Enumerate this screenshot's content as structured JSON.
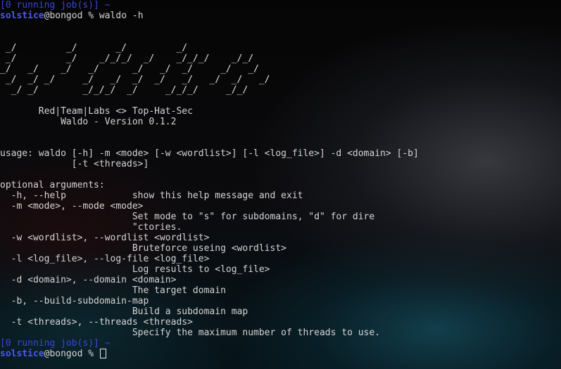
{
  "terminal": {
    "colors": {
      "prompt_user": "#4a58f0",
      "jobs_text": "#3a46d8",
      "text": "#d4d4d4"
    },
    "top_jobs": "[0 running job(s)] ~",
    "prompt1": {
      "user": "solstice",
      "host": "@bongod",
      "rest": " % waldo -h"
    },
    "banner": [
      " _/         _/       _/         _/",
      " _/         _/    _/_/_/  _/    _/_/_/    _/_/",
      "_/   _/    _/   _/      _/   _/  _/     _/   _/",
      " _/  _/ _/     _/   _/  _/  _/   _/   _/  _/   _/",
      "  _/ _/        _/_/_/  _/     _/_/_/     _/_/"
    ],
    "credits": [
      "       Red|Team|Labs <> Top-Hat-Sec",
      "           Waldo - Version 0.1.2"
    ],
    "usage": [
      "usage: waldo [-h] -m <mode> [-w <wordlist>] [-l <log_file>] -d <domain> [-b]",
      "             [-t <threads>]"
    ],
    "optional_header": "optional arguments:",
    "options": [
      "  -h, --help            show this help message and exit",
      "  -m <mode>, --mode <mode>",
      "                        Set mode to \"s\" for subdomains, \"d\" for dire",
      "                        \"ctories.",
      "  -w <wordlist>, --wordlist <wordlist>",
      "                        Bruteforce useing <wordlist>",
      "  -l <log_file>, --log-file <log_file>",
      "                        Log results to <log_file>",
      "  -d <domain>, --domain <domain>",
      "                        The target domain",
      "  -b, --build-subdomain-map",
      "                        Build a subdomain map",
      "  -t <threads>, --threads <threads>",
      "                        Specify the maximum number of threads to use."
    ],
    "bottom_jobs": "[0 running job(s)] ~",
    "prompt2": {
      "user": "solstice",
      "host": "@bongod",
      "rest": " % "
    }
  }
}
